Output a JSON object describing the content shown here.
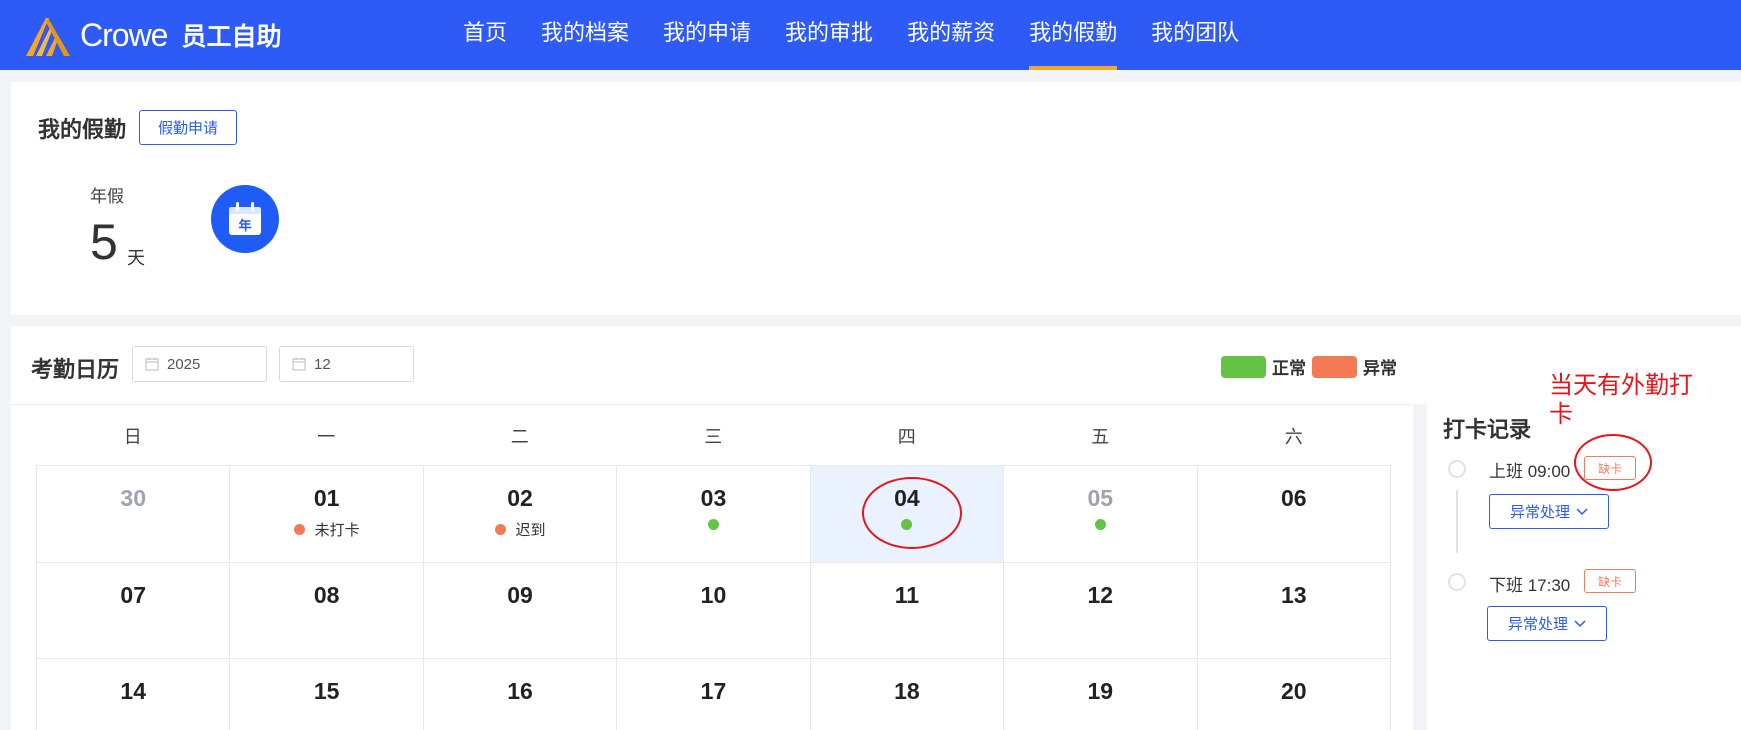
{
  "header": {
    "brand_name": "Crowe",
    "brand_sub": "员工自助",
    "nav": [
      {
        "label": "首页"
      },
      {
        "label": "我的档案"
      },
      {
        "label": "我的申请"
      },
      {
        "label": "我的审批"
      },
      {
        "label": "我的薪资"
      },
      {
        "label": "我的假勤",
        "active": true
      },
      {
        "label": "我的团队"
      }
    ],
    "accent": "#f5a623",
    "bg": "#2e5bf5"
  },
  "leave": {
    "title": "我的假勤",
    "apply_button": "假勤申请",
    "type_label": "年假",
    "days": "5",
    "unit": "天",
    "icon_char": "年"
  },
  "calendar": {
    "title": "考勤日历",
    "year": "2025",
    "month": "12",
    "legend": [
      {
        "label": "正常",
        "color": "#64c244"
      },
      {
        "label": "异常",
        "color": "#f47a55"
      }
    ],
    "weekdays": [
      "日",
      "一",
      "二",
      "三",
      "四",
      "五",
      "六"
    ],
    "weeks": [
      [
        {
          "day": "30",
          "muted": true
        },
        {
          "day": "01",
          "status": "abnormal",
          "text": "未打卡"
        },
        {
          "day": "02",
          "status": "abnormal",
          "text": "迟到"
        },
        {
          "day": "03",
          "status": "normal"
        },
        {
          "day": "04",
          "status": "normal",
          "selected": true
        },
        {
          "day": "05",
          "status": "normal",
          "muted": true
        },
        {
          "day": "06"
        }
      ],
      [
        {
          "day": "07"
        },
        {
          "day": "08"
        },
        {
          "day": "09"
        },
        {
          "day": "10"
        },
        {
          "day": "11"
        },
        {
          "day": "12"
        },
        {
          "day": "13"
        }
      ],
      [
        {
          "day": "14"
        },
        {
          "day": "15"
        },
        {
          "day": "16"
        },
        {
          "day": "17"
        },
        {
          "day": "18"
        },
        {
          "day": "19"
        },
        {
          "day": "20"
        }
      ]
    ]
  },
  "punch": {
    "title": "打卡记录",
    "annotation": "当天有外勤打卡",
    "records": [
      {
        "label": "上班 09:00",
        "tag": "缺卡",
        "action": "异常处理"
      },
      {
        "label": "下班 17:30",
        "tag": "缺卡",
        "action": "异常处理"
      }
    ]
  }
}
